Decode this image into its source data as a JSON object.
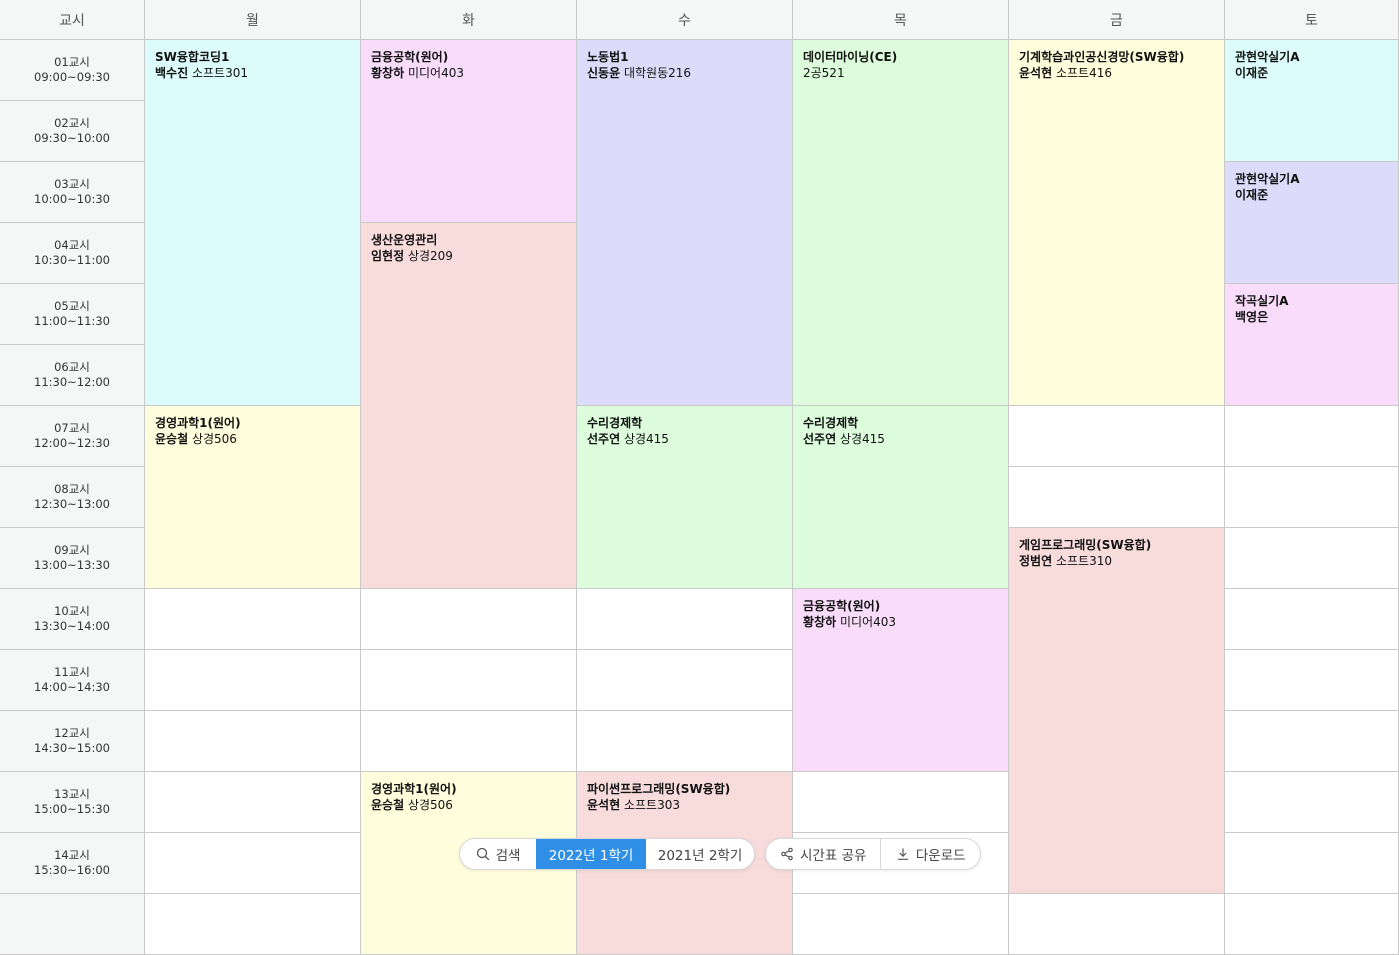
{
  "header": {
    "period_label": "교시",
    "days": [
      "월",
      "화",
      "수",
      "목",
      "금",
      "토"
    ]
  },
  "periods": [
    {
      "label": "01교시",
      "time": "09:00~09:30"
    },
    {
      "label": "02교시",
      "time": "09:30~10:00"
    },
    {
      "label": "03교시",
      "time": "10:00~10:30"
    },
    {
      "label": "04교시",
      "time": "10:30~11:00"
    },
    {
      "label": "05교시",
      "time": "11:00~11:30"
    },
    {
      "label": "06교시",
      "time": "11:30~12:00"
    },
    {
      "label": "07교시",
      "time": "12:00~12:30"
    },
    {
      "label": "08교시",
      "time": "12:30~13:00"
    },
    {
      "label": "09교시",
      "time": "13:00~13:30"
    },
    {
      "label": "10교시",
      "time": "13:30~14:00"
    },
    {
      "label": "11교시",
      "time": "14:00~14:30"
    },
    {
      "label": "12교시",
      "time": "14:30~15:00"
    },
    {
      "label": "13교시",
      "time": "15:00~15:30"
    },
    {
      "label": "14교시",
      "time": "15:30~16:00"
    },
    {
      "label": "",
      "time": ""
    }
  ],
  "courses": [
    {
      "day": 0,
      "start": 0,
      "span": 6,
      "name": "SW융합코딩1",
      "prof": "백수진",
      "room": "소프트301",
      "color": "#dcfcfc"
    },
    {
      "day": 0,
      "start": 6,
      "span": 3,
      "name": "경영과학1(원어)",
      "prof": "윤승철",
      "room": "상경506",
      "color": "#fefedc"
    },
    {
      "day": 1,
      "start": 0,
      "span": 3,
      "name": "금융공학(원어)",
      "prof": "황창하",
      "room": "미디어403",
      "color": "#f8dcfa"
    },
    {
      "day": 1,
      "start": 3,
      "span": 6,
      "name": "생산운영관리",
      "prof": "임현정",
      "room": "상경209",
      "color": "#f8dcdc"
    },
    {
      "day": 1,
      "start": 12,
      "span": 3,
      "name": "경영과학1(원어)",
      "prof": "윤승철",
      "room": "상경506",
      "color": "#fefedc"
    },
    {
      "day": 2,
      "start": 0,
      "span": 6,
      "name": "노동법1",
      "prof": "신동윤",
      "room": "대학원동216",
      "color": "#dcdcfa"
    },
    {
      "day": 2,
      "start": 6,
      "span": 3,
      "name": "수리경제학",
      "prof": "선주연",
      "room": "상경415",
      "color": "#dcfcdc"
    },
    {
      "day": 2,
      "start": 12,
      "span": 3,
      "name": "파이썬프로그래밍(SW융합)",
      "prof": "윤석현",
      "room": "소프트303",
      "color": "#f8dcdc"
    },
    {
      "day": 3,
      "start": 0,
      "span": 6,
      "name": "데이터마이닝(CE)",
      "prof": "",
      "room": "2공521",
      "color": "#dcfcdc"
    },
    {
      "day": 3,
      "start": 6,
      "span": 3,
      "name": "수리경제학",
      "prof": "선주연",
      "room": "상경415",
      "color": "#dcfcdc"
    },
    {
      "day": 3,
      "start": 9,
      "span": 3,
      "name": "금융공학(원어)",
      "prof": "황창하",
      "room": "미디어403",
      "color": "#f8dcfa"
    },
    {
      "day": 4,
      "start": 0,
      "span": 6,
      "name": "기계학습과인공신경망(SW융합)",
      "prof": "윤석현",
      "room": "소프트416",
      "color": "#fefedc"
    },
    {
      "day": 4,
      "start": 8,
      "span": 6,
      "name": "게임프로그래밍(SW융합)",
      "prof": "정범연",
      "room": "소프트310",
      "color": "#f8dcdc"
    },
    {
      "day": 5,
      "start": 0,
      "span": 2,
      "name": "관현악실기A",
      "prof": "이재준",
      "room": "",
      "color": "#dcfcfc"
    },
    {
      "day": 5,
      "start": 2,
      "span": 2,
      "name": "관현악실기A",
      "prof": "이재준",
      "room": "",
      "color": "#dcdcfa"
    },
    {
      "day": 5,
      "start": 4,
      "span": 2,
      "name": "작곡실기A",
      "prof": "백영은",
      "room": "",
      "color": "#f8dcfa"
    }
  ],
  "toolbar": {
    "search_label": "검색",
    "semesters": [
      "2022년 1학기",
      "2021년 2학기"
    ],
    "active_semester": "2022년 1학기",
    "share_label": "시간표 공유",
    "download_label": "다운로드",
    "accent_color": "#2f8fe6"
  }
}
